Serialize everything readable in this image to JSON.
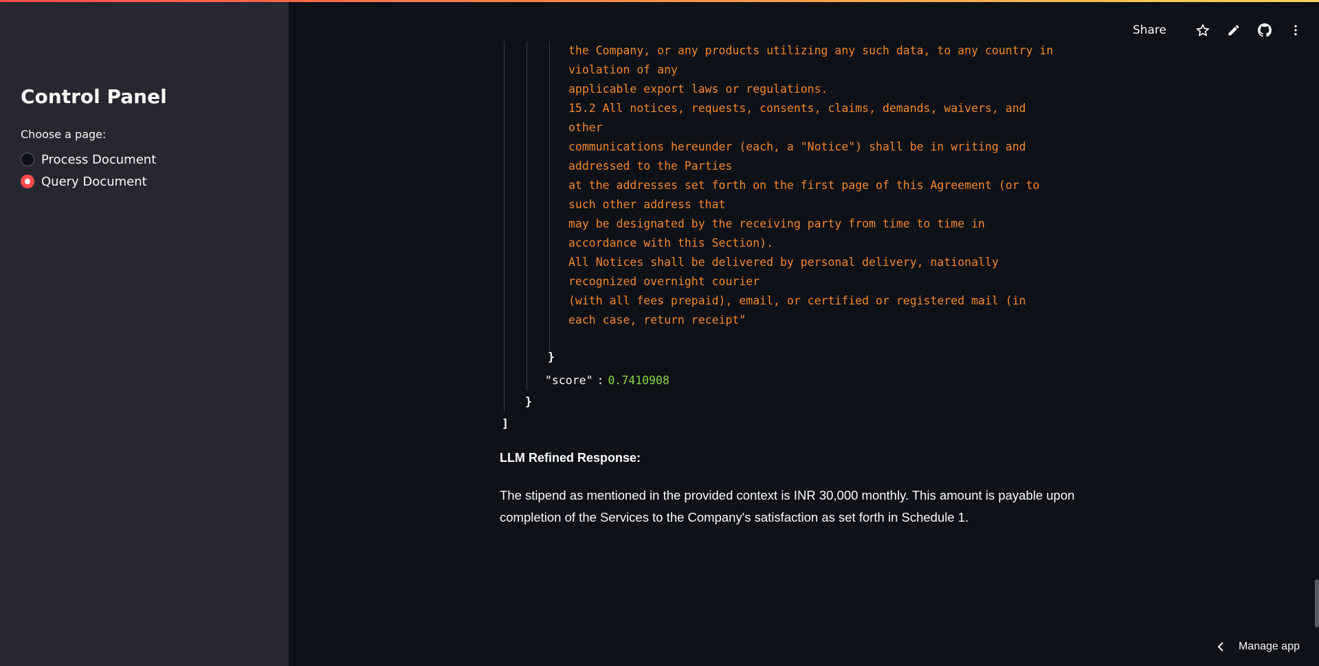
{
  "sidebar": {
    "title": "Control Panel",
    "radio_label": "Choose a page:",
    "options": [
      {
        "label": "Process Document",
        "selected": false
      },
      {
        "label": "Query Document",
        "selected": true
      }
    ]
  },
  "toolbar": {
    "share_label": "Share",
    "icons": [
      "star-icon",
      "pencil-icon",
      "github-icon",
      "more-vertical-icon"
    ]
  },
  "json_output": {
    "content_lines": [
      "the Company, or any products utilizing any such data, to any country in",
      "violation of any",
      "applicable export laws or regulations.",
      "15.2 All notices, requests, consents, claims, demands, waivers, and",
      "other",
      "communications hereunder (each, a \"Notice\") shall be in writing and",
      "addressed to the Parties",
      "at the addresses set forth on the first page of this Agreement (or to",
      "such other address that",
      "may be designated by the receiving party from time to time in",
      "accordance with this Section).",
      "All Notices shall be delivered by personal delivery, nationally",
      "recognized overnight courier",
      "(with all fees prepaid), email, or certified or registered mail (in",
      "each case, return receipt\""
    ],
    "close_brace": "}",
    "score_key": "\"score\"",
    "score_colon": ":",
    "score_value": "0.7410908",
    "close_object": "}",
    "close_array": "]"
  },
  "response": {
    "heading": "LLM Refined Response:",
    "text": "The stipend as mentioned in the provided context is INR 30,000 monthly. This amount is payable upon completion of the Services to the Company's satisfaction as set forth in Schedule 1."
  },
  "footer": {
    "manage_label": "Manage app"
  },
  "colors": {
    "accent": "#ff4b4b",
    "string_text": "#f2872e",
    "number_text": "#8bd449",
    "sidebar_bg": "#262730",
    "main_bg": "#0e1117"
  }
}
